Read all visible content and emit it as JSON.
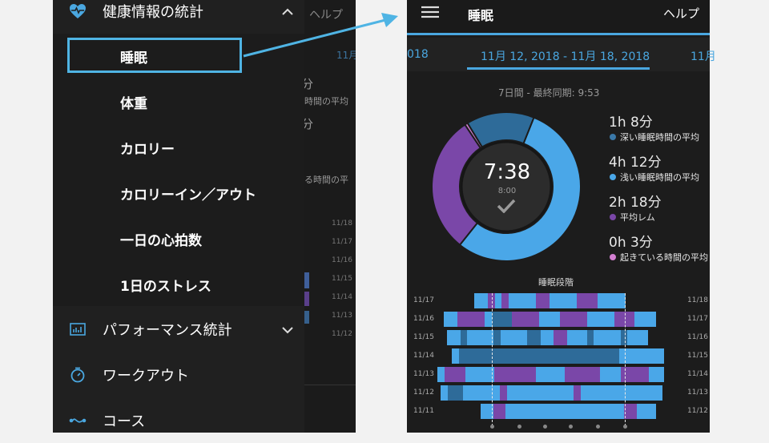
{
  "left": {
    "drawer": {
      "section_health": {
        "label": "健康情報の統計",
        "icon": "heart-icon",
        "expanded": true
      },
      "sub_items": [
        {
          "label": "睡眠",
          "selected": true
        },
        {
          "label": "体重"
        },
        {
          "label": "カロリー"
        },
        {
          "label": "カロリーイン／アウト"
        },
        {
          "label": "一日の心拍数"
        },
        {
          "label": "1日のストレス"
        }
      ],
      "performance": {
        "label": "パフォーマンス統計",
        "icon": "chart-icon"
      },
      "workout": {
        "label": "ワークアウト",
        "icon": "stopwatch-icon"
      },
      "course": {
        "label": "コース",
        "icon": "course-icon"
      }
    },
    "behind": {
      "help": "ヘルプ",
      "date": "11月",
      "frag1": "分",
      "frag2": "時間の平均",
      "frag3": "分",
      "frag4": "る時間の平",
      "dates": [
        "11/18",
        "11/17",
        "11/16",
        "11/15",
        "11/14",
        "11/13",
        "11/12"
      ]
    }
  },
  "right": {
    "header": {
      "title": "睡眠",
      "help": "ヘルプ",
      "menu_icon": "hamburger-icon"
    },
    "tabs": {
      "prev": "018",
      "current": "11月 12, 2018 - 11月 18, 2018",
      "next": "11月"
    },
    "sync_text": "7日間 - 最終同期: 9:53",
    "donut": {
      "center_time": "7:38",
      "goal": "8:00",
      "segments": [
        {
          "name": "浅い睡眠",
          "minutes": 252,
          "color": "#4aa7e8"
        },
        {
          "name": "平均レム",
          "minutes": 138,
          "color": "#7a47a8"
        },
        {
          "name": "起きている時間",
          "minutes": 3,
          "color": "#d37fd1"
        },
        {
          "name": "深い睡眠",
          "minutes": 68,
          "color": "#2e6b99"
        }
      ]
    },
    "legend": [
      {
        "value": "1h 8分",
        "label": "深い睡眠時間の平均",
        "color": "#3a78a8"
      },
      {
        "value": "4h 12分",
        "label": "浅い睡眠時間の平均",
        "color": "#4aa7e8"
      },
      {
        "value": "2h 18分",
        "label": "平均レム",
        "color": "#7a47a8"
      },
      {
        "value": "0h 3分",
        "label": "起きている時間の平均",
        "color": "#d37fd1"
      }
    ],
    "stages": {
      "title": "睡眠段階",
      "days": [
        "11/17",
        "11/16",
        "11/15",
        "11/14",
        "11/13",
        "11/12",
        "11/11"
      ],
      "days_right": [
        "11/18",
        "11/17",
        "11/16",
        "11/15",
        "11/14",
        "11/13",
        "11/12"
      ]
    }
  }
}
